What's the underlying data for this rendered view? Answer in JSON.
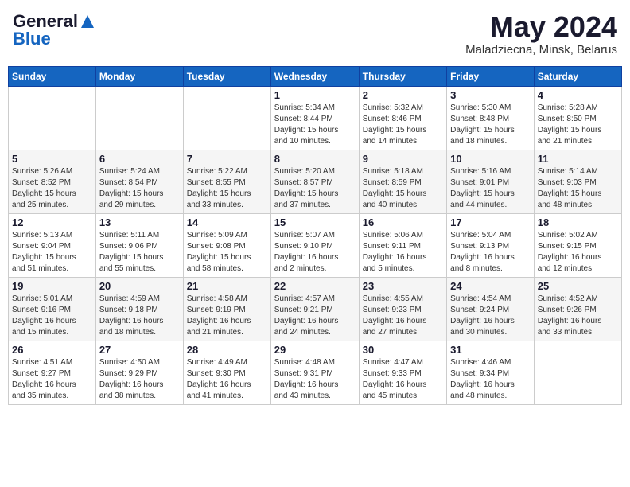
{
  "header": {
    "logo_general": "General",
    "logo_blue": "Blue",
    "month_title": "May 2024",
    "location": "Maladziecna, Minsk, Belarus"
  },
  "calendar": {
    "days_of_week": [
      "Sunday",
      "Monday",
      "Tuesday",
      "Wednesday",
      "Thursday",
      "Friday",
      "Saturday"
    ],
    "weeks": [
      [
        {
          "day": "",
          "info": ""
        },
        {
          "day": "",
          "info": ""
        },
        {
          "day": "",
          "info": ""
        },
        {
          "day": "1",
          "info": "Sunrise: 5:34 AM\nSunset: 8:44 PM\nDaylight: 15 hours\nand 10 minutes."
        },
        {
          "day": "2",
          "info": "Sunrise: 5:32 AM\nSunset: 8:46 PM\nDaylight: 15 hours\nand 14 minutes."
        },
        {
          "day": "3",
          "info": "Sunrise: 5:30 AM\nSunset: 8:48 PM\nDaylight: 15 hours\nand 18 minutes."
        },
        {
          "day": "4",
          "info": "Sunrise: 5:28 AM\nSunset: 8:50 PM\nDaylight: 15 hours\nand 21 minutes."
        }
      ],
      [
        {
          "day": "5",
          "info": "Sunrise: 5:26 AM\nSunset: 8:52 PM\nDaylight: 15 hours\nand 25 minutes."
        },
        {
          "day": "6",
          "info": "Sunrise: 5:24 AM\nSunset: 8:54 PM\nDaylight: 15 hours\nand 29 minutes."
        },
        {
          "day": "7",
          "info": "Sunrise: 5:22 AM\nSunset: 8:55 PM\nDaylight: 15 hours\nand 33 minutes."
        },
        {
          "day": "8",
          "info": "Sunrise: 5:20 AM\nSunset: 8:57 PM\nDaylight: 15 hours\nand 37 minutes."
        },
        {
          "day": "9",
          "info": "Sunrise: 5:18 AM\nSunset: 8:59 PM\nDaylight: 15 hours\nand 40 minutes."
        },
        {
          "day": "10",
          "info": "Sunrise: 5:16 AM\nSunset: 9:01 PM\nDaylight: 15 hours\nand 44 minutes."
        },
        {
          "day": "11",
          "info": "Sunrise: 5:14 AM\nSunset: 9:03 PM\nDaylight: 15 hours\nand 48 minutes."
        }
      ],
      [
        {
          "day": "12",
          "info": "Sunrise: 5:13 AM\nSunset: 9:04 PM\nDaylight: 15 hours\nand 51 minutes."
        },
        {
          "day": "13",
          "info": "Sunrise: 5:11 AM\nSunset: 9:06 PM\nDaylight: 15 hours\nand 55 minutes."
        },
        {
          "day": "14",
          "info": "Sunrise: 5:09 AM\nSunset: 9:08 PM\nDaylight: 15 hours\nand 58 minutes."
        },
        {
          "day": "15",
          "info": "Sunrise: 5:07 AM\nSunset: 9:10 PM\nDaylight: 16 hours\nand 2 minutes."
        },
        {
          "day": "16",
          "info": "Sunrise: 5:06 AM\nSunset: 9:11 PM\nDaylight: 16 hours\nand 5 minutes."
        },
        {
          "day": "17",
          "info": "Sunrise: 5:04 AM\nSunset: 9:13 PM\nDaylight: 16 hours\nand 8 minutes."
        },
        {
          "day": "18",
          "info": "Sunrise: 5:02 AM\nSunset: 9:15 PM\nDaylight: 16 hours\nand 12 minutes."
        }
      ],
      [
        {
          "day": "19",
          "info": "Sunrise: 5:01 AM\nSunset: 9:16 PM\nDaylight: 16 hours\nand 15 minutes."
        },
        {
          "day": "20",
          "info": "Sunrise: 4:59 AM\nSunset: 9:18 PM\nDaylight: 16 hours\nand 18 minutes."
        },
        {
          "day": "21",
          "info": "Sunrise: 4:58 AM\nSunset: 9:19 PM\nDaylight: 16 hours\nand 21 minutes."
        },
        {
          "day": "22",
          "info": "Sunrise: 4:57 AM\nSunset: 9:21 PM\nDaylight: 16 hours\nand 24 minutes."
        },
        {
          "day": "23",
          "info": "Sunrise: 4:55 AM\nSunset: 9:23 PM\nDaylight: 16 hours\nand 27 minutes."
        },
        {
          "day": "24",
          "info": "Sunrise: 4:54 AM\nSunset: 9:24 PM\nDaylight: 16 hours\nand 30 minutes."
        },
        {
          "day": "25",
          "info": "Sunrise: 4:52 AM\nSunset: 9:26 PM\nDaylight: 16 hours\nand 33 minutes."
        }
      ],
      [
        {
          "day": "26",
          "info": "Sunrise: 4:51 AM\nSunset: 9:27 PM\nDaylight: 16 hours\nand 35 minutes."
        },
        {
          "day": "27",
          "info": "Sunrise: 4:50 AM\nSunset: 9:29 PM\nDaylight: 16 hours\nand 38 minutes."
        },
        {
          "day": "28",
          "info": "Sunrise: 4:49 AM\nSunset: 9:30 PM\nDaylight: 16 hours\nand 41 minutes."
        },
        {
          "day": "29",
          "info": "Sunrise: 4:48 AM\nSunset: 9:31 PM\nDaylight: 16 hours\nand 43 minutes."
        },
        {
          "day": "30",
          "info": "Sunrise: 4:47 AM\nSunset: 9:33 PM\nDaylight: 16 hours\nand 45 minutes."
        },
        {
          "day": "31",
          "info": "Sunrise: 4:46 AM\nSunset: 9:34 PM\nDaylight: 16 hours\nand 48 minutes."
        },
        {
          "day": "",
          "info": ""
        }
      ]
    ]
  }
}
